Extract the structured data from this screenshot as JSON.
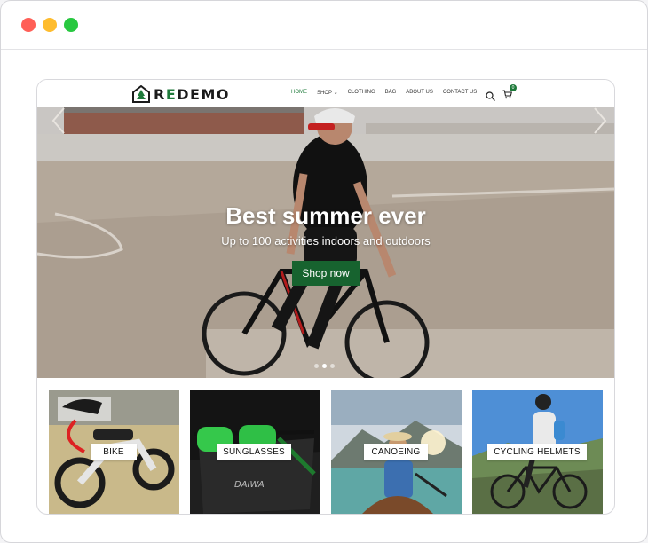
{
  "window": {
    "controls": [
      "close",
      "minimize",
      "zoom"
    ]
  },
  "brand": {
    "logo_text": "REDEMO",
    "accent": "#1e7a3a"
  },
  "nav": {
    "items": [
      "HOME",
      "SHOP",
      "CLOTHING",
      "BAG",
      "ABOUT US",
      "CONTACT US"
    ],
    "active": "HOME",
    "cart_count": "0",
    "icons": [
      "search-icon",
      "cart-icon"
    ]
  },
  "hero": {
    "title": "Best summer ever",
    "subtitle": "Up to 100 activities indoors and outdoors",
    "button": "Shop now",
    "slides_total": 3,
    "slide_current": 2
  },
  "categories": [
    {
      "label": "BIKE"
    },
    {
      "label": "SUNGLASSES"
    },
    {
      "label": "CANOEING"
    },
    {
      "label": "CYCLING HELMETS"
    }
  ]
}
